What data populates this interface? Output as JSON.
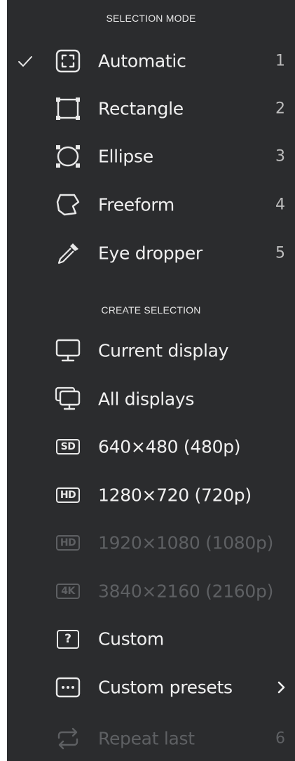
{
  "menu": {
    "sections": {
      "selection_mode": "SELECTION MODE",
      "create_selection": "CREATE SELECTION"
    },
    "selection_mode_items": [
      {
        "label": "Automatic",
        "shortcut": "1",
        "icon": "automatic-select-icon",
        "checked": true
      },
      {
        "label": "Rectangle",
        "shortcut": "2",
        "icon": "rectangle-select-icon"
      },
      {
        "label": "Ellipse",
        "shortcut": "3",
        "icon": "ellipse-select-icon"
      },
      {
        "label": "Freeform",
        "shortcut": "4",
        "icon": "freeform-select-icon"
      },
      {
        "label": "Eye dropper",
        "shortcut": "5",
        "icon": "eye-dropper-icon"
      }
    ],
    "create_selection_items": [
      {
        "label": "Current display",
        "icon": "monitor-icon"
      },
      {
        "label": "All displays",
        "icon": "multi-monitor-icon"
      },
      {
        "label": "640×480 (480p)",
        "badge": "SD",
        "icon": "sd-badge-icon"
      },
      {
        "label": "1280×720 (720p)",
        "badge": "HD",
        "icon": "hd-badge-icon"
      },
      {
        "label": "1920×1080 (1080p)",
        "badge": "HD",
        "icon": "hd-badge-icon",
        "disabled": true
      },
      {
        "label": "3840×2160 (2160p)",
        "badge": "4K",
        "icon": "4k-badge-icon",
        "disabled": true
      },
      {
        "label": "Custom",
        "badge": "?",
        "icon": "question-box-icon"
      },
      {
        "label": "Custom presets",
        "icon": "ellipsis-box-icon",
        "submenu": true
      },
      {
        "label": "Repeat last",
        "shortcut": "6",
        "icon": "repeat-icon",
        "disabled": true
      }
    ]
  },
  "colors": {
    "background": "#2b2c2e",
    "text": "#f0f0f0",
    "disabled_text": "#5e6063",
    "shortcut_text": "#bdbdbd"
  }
}
